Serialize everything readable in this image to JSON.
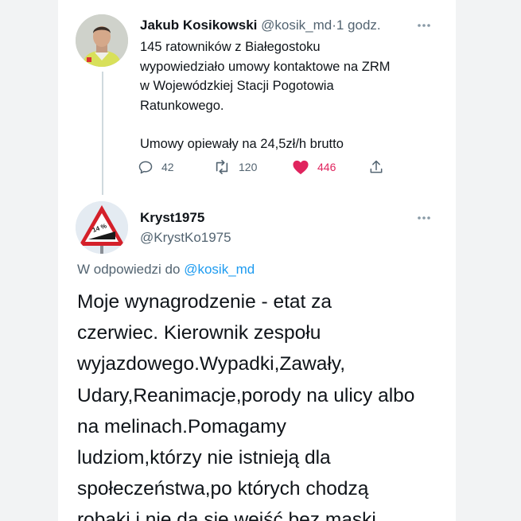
{
  "parent_tweet": {
    "author_name": "Jakub Kosikowski",
    "author_handle": "@kosik_md",
    "separator": "·",
    "time": "1 godz.",
    "more_icon": "more-horizontal-icon",
    "text_lines": [
      "145 ratowników z Białegostoku",
      "wypowiedziało umowy kontaktowe na ZRM",
      "w Wojewódzkiej Stacji Pogotowia",
      "Ratunkowego."
    ],
    "text_line_2": "Umowy opiewały na 24,5zł/h brutto",
    "actions": {
      "reply_count": "42",
      "retweet_count": "120",
      "like_count": "446",
      "like_color": "#e0245e"
    }
  },
  "reply_tweet": {
    "author_name": "Kryst1975",
    "author_handle": "@KrystKo1975",
    "more_icon": "more-horizontal-icon",
    "reply_prefix": "W odpowiedzi do",
    "reply_to_handle": "@kosik_md",
    "text_lines": [
      "Moje wynagrodzenie - etat za",
      "czerwiec. Kierownik zespołu",
      "wyjazdowego.Wypadki,Zawały,",
      "Udary,Reanimacje,porody na ulicy albo",
      "na melinach.Pomagamy",
      "ludziom,którzy nie istnieją dla",
      "społeczeństwa,po których chodzą",
      "robaki i nie da się wejść bez maski"
    ],
    "avatar_sign_text": "14 %"
  },
  "colors": {
    "link": "#1d9bf0",
    "secondary_text": "#536471",
    "thread_line": "#cfd9de"
  }
}
